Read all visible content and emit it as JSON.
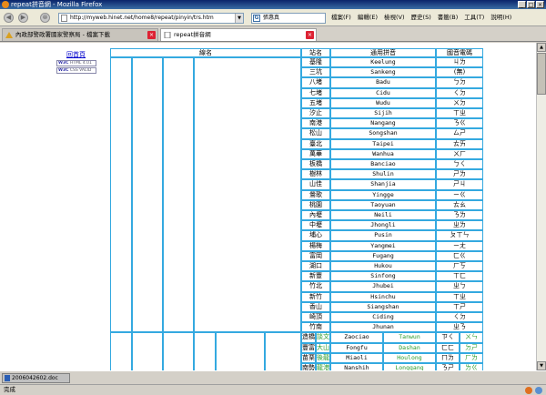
{
  "window": {
    "title": "repeat拼音網 - Mozilla Firefox",
    "min": "_",
    "max": "□",
    "close": "×"
  },
  "nav": {
    "back": "◀",
    "forward": "▶",
    "stop": "⊗",
    "url": "http://myweb.hinet.net/home8/repeat/pinyin/trs.htm",
    "search_value": "張惠真",
    "menu": [
      "檔案(F)",
      "編輯(E)",
      "檢視(V)",
      "歷史(S)",
      "書籤(B)",
      "工具(T)",
      "說明(H)"
    ]
  },
  "tabs": [
    {
      "label": "內政部警政署國家警察局 - 檔案下載",
      "close": "×"
    },
    {
      "label": "repeat拼音網",
      "close": "×"
    }
  ],
  "page": {
    "home_link": "回首頁",
    "badges": [
      {
        "w3c": "W3C",
        "text": "HTML 4.01"
      },
      {
        "w3c": "W3C",
        "text": "CSS VALID"
      }
    ],
    "headers": {
      "line": "線名",
      "station": "站名",
      "pinyin": "通用拼音",
      "zhuyin": "國音電碼"
    },
    "rows": [
      {
        "station": "基隆",
        "pinyin": "Keelung",
        "zhuyin": "ㄐㄌ"
      },
      {
        "station": "三坑",
        "pinyin": "Sankeng",
        "zhuyin": "(無)"
      },
      {
        "station": "八堵",
        "pinyin": "Badu",
        "zhuyin": "ㄅㄉ"
      },
      {
        "station": "七堵",
        "pinyin": "Cidu",
        "zhuyin": "ㄑㄉ"
      },
      {
        "station": "五堵",
        "pinyin": "Wudu",
        "zhuyin": "ㄨㄉ"
      },
      {
        "station": "汐止",
        "pinyin": "Sijih",
        "zhuyin": "ㄒㄓ"
      },
      {
        "station": "南港",
        "pinyin": "Nangang",
        "zhuyin": "ㄋㄍ"
      },
      {
        "station": "松山",
        "pinyin": "Songshan",
        "zhuyin": "ㄙㄕ"
      },
      {
        "station": "臺北",
        "pinyin": "Taipei",
        "zhuyin": "ㄊㄞ"
      },
      {
        "station": "萬華",
        "pinyin": "Wanhua",
        "zhuyin": "ㄨㄏ"
      },
      {
        "station": "板橋",
        "pinyin": "Banciao",
        "zhuyin": "ㄅㄑ"
      },
      {
        "station": "樹林",
        "pinyin": "Shulin",
        "zhuyin": "ㄕㄌ"
      },
      {
        "station": "山佳",
        "pinyin": "Shanjia",
        "zhuyin": "ㄕㄐ"
      },
      {
        "station": "鶯歌",
        "pinyin": "Yingge",
        "zhuyin": "ㄧㄍ"
      },
      {
        "station": "桃園",
        "pinyin": "Taoyuan",
        "zhuyin": "ㄊㄠ"
      },
      {
        "station": "內壢",
        "pinyin": "Neili",
        "zhuyin": "ㄋㄌ"
      },
      {
        "station": "中壢",
        "pinyin": "Jhongli",
        "zhuyin": "ㄓㄌ"
      },
      {
        "station": "埔心",
        "pinyin": "Pusin",
        "zhuyin": "ㄆㄒㄣ"
      },
      {
        "station": "楊梅",
        "pinyin": "Yangmei",
        "zhuyin": "ㄧㄤ"
      },
      {
        "station": "富岡",
        "pinyin": "Fugang",
        "zhuyin": "ㄈㄍ"
      },
      {
        "station": "湖口",
        "pinyin": "Hukou",
        "zhuyin": "ㄏㄎ"
      },
      {
        "station": "新豐",
        "pinyin": "Sinfong",
        "zhuyin": "ㄒㄈ"
      },
      {
        "station": "竹北",
        "pinyin": "Jhubei",
        "zhuyin": "ㄓㄅ"
      },
      {
        "station": "新竹",
        "pinyin": "Hsinchu",
        "zhuyin": "ㄒㄓ"
      },
      {
        "station": "香山",
        "pinyin": "Siangshan",
        "zhuyin": "ㄒㄕ"
      },
      {
        "station": "崎頂",
        "pinyin": "Ciding",
        "zhuyin": "ㄑㄉ"
      },
      {
        "station": "竹南",
        "pinyin": "Jhunan",
        "zhuyin": "ㄓㄋ"
      }
    ],
    "branch_rows": [
      {
        "station": "造橋",
        "alt": "談文",
        "pinyin": "Zaociao",
        "alt_pinyin": "Tanwun",
        "zhuyin": "ㄗㄑ",
        "alt_zhuyin": "ㄨㄣ"
      },
      {
        "station": "豐富",
        "alt": "大山",
        "pinyin": "Fongfu",
        "alt_pinyin": "Dashan",
        "zhuyin": "ㄈㄈ",
        "alt_zhuyin": "ㄉㄕ"
      },
      {
        "station": "苗栗",
        "alt": "後龍",
        "pinyin": "Miaoli",
        "alt_pinyin": "Houlong",
        "zhuyin": "ㄇㄌ",
        "alt_zhuyin": "ㄏㄌ"
      },
      {
        "station": "南勢",
        "alt": "龍港",
        "pinyin": "Nanshih",
        "alt_pinyin": "Longgang",
        "zhuyin": "ㄋㄕ",
        "alt_zhuyin": "ㄌㄍ"
      }
    ]
  },
  "downloads": {
    "file": "2006042602.doc"
  },
  "status": {
    "text": "完成"
  }
}
